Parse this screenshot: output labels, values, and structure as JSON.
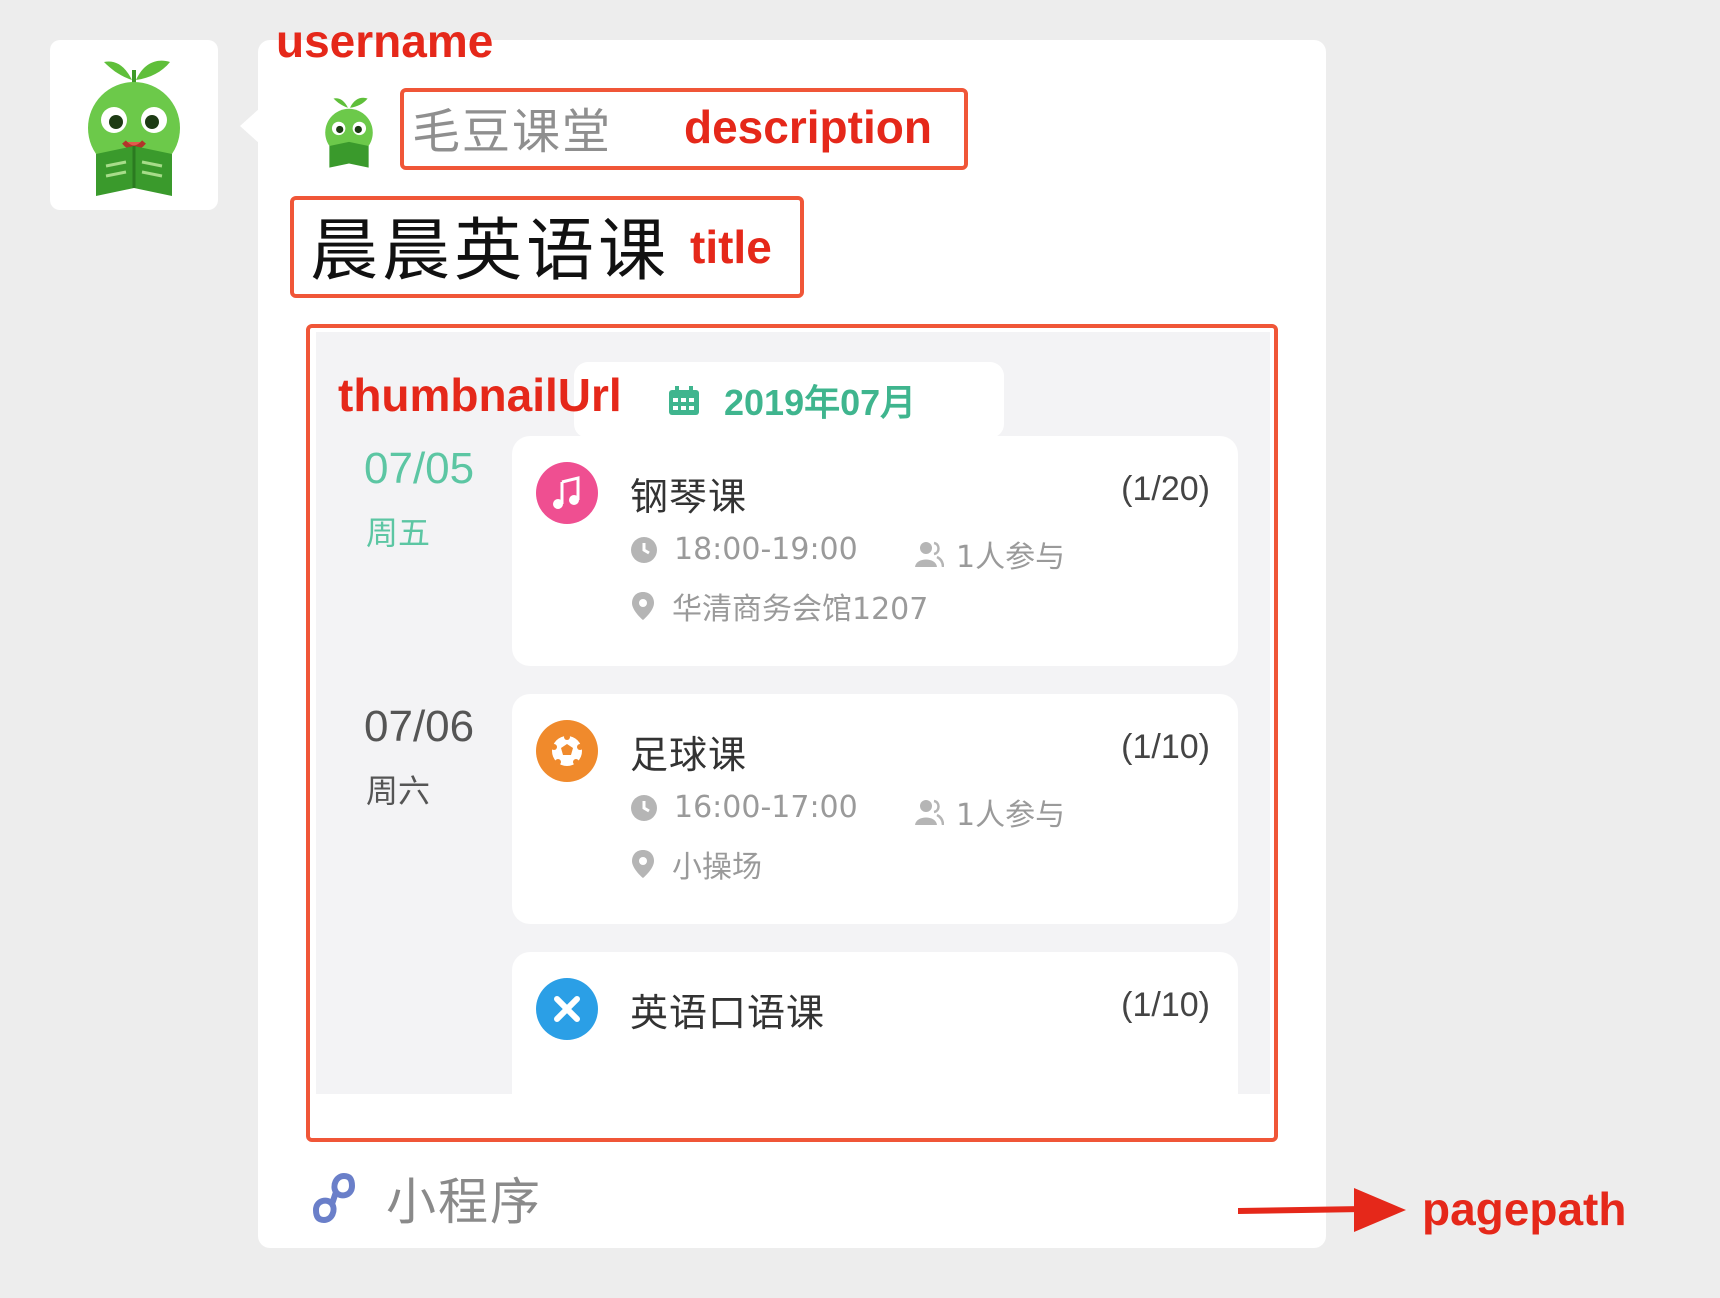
{
  "annotations": {
    "username": "username",
    "description": "description",
    "title": "title",
    "thumbnail": "thumbnailUrl",
    "pagepath": "pagepath"
  },
  "card": {
    "app_name": "毛豆课堂",
    "title": "晨晨英语课",
    "footer_label": "小程序"
  },
  "thumbnail": {
    "month": "2019年07月",
    "days": [
      {
        "date": "07/05",
        "weekday": "周五"
      },
      {
        "date": "07/06",
        "weekday": "周六"
      }
    ],
    "events": [
      {
        "name": "钢琴课",
        "count": "(1/20)",
        "time": "18:00-19:00",
        "people": "1人参与",
        "location": "华清商务会馆1207",
        "icon": "music-note-icon",
        "color": "#ef4f91"
      },
      {
        "name": "足球课",
        "count": "(1/10)",
        "time": "16:00-17:00",
        "people": "1人参与",
        "location": "小操场",
        "icon": "soccer-ball-icon",
        "color": "#f08a2c"
      },
      {
        "name": "英语口语课",
        "count": "(1/10)",
        "icon": "cross-tools-icon",
        "color": "#2b9fe6"
      }
    ]
  },
  "colors": {
    "accent_green": "#3fb58e",
    "annotation_red": "#e5281a"
  }
}
